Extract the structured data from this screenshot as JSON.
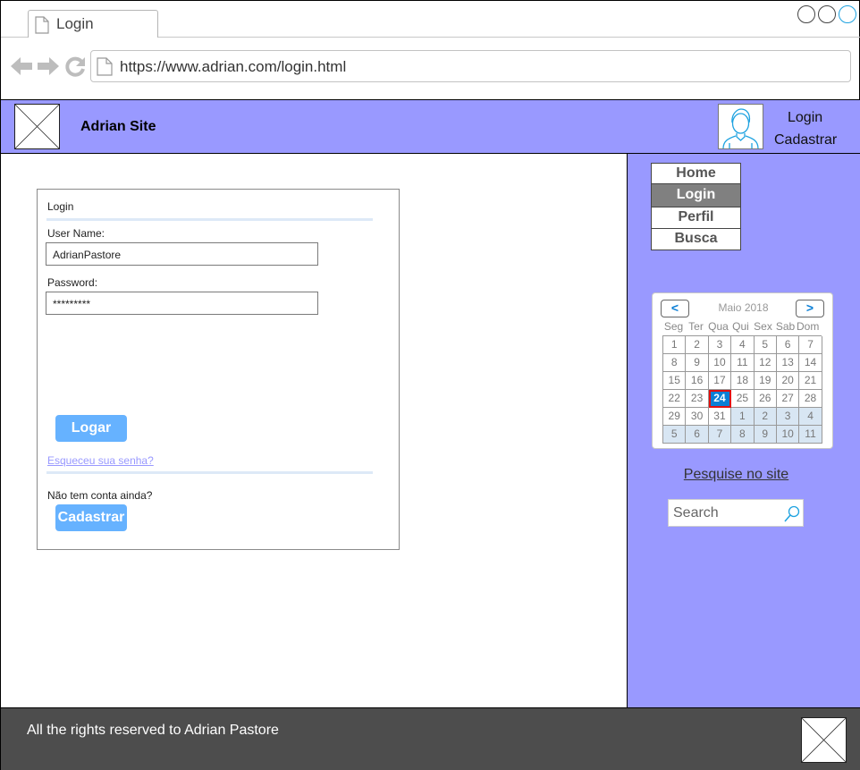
{
  "browser": {
    "tab_title": "Login",
    "url": "https://www.adrian.com/login.html",
    "colors": {
      "window_accent": "#1ea2e0"
    }
  },
  "header": {
    "site_title": "Adrian Site",
    "links": [
      "Login",
      "Cadastrar"
    ],
    "colors": {
      "background": "#9999ff"
    }
  },
  "login_form": {
    "title": "Login",
    "username_label": "User Name:",
    "username_value": "AdrianPastore",
    "password_label": "Password:",
    "password_value": "*********",
    "submit_label": "Logar",
    "forgot_link": "Esqueceu sua senha?",
    "no_account_text": "Não tem conta ainda?",
    "signup_label": "Cadastrar",
    "colors": {
      "button": "#66b2ff",
      "link": "#9999ff"
    }
  },
  "sidebar": {
    "menu": [
      {
        "label": "Home",
        "active": false
      },
      {
        "label": "Login",
        "active": true
      },
      {
        "label": "Perfil",
        "active": false
      },
      {
        "label": "Busca",
        "active": false
      }
    ],
    "calendar": {
      "prev_label": "<",
      "next_label": ">",
      "month_label": "Maio 2018",
      "weekdays": [
        "Seg",
        "Ter",
        "Qua",
        "Qui",
        "Sex",
        "Sab",
        "Dom"
      ],
      "weeks": [
        [
          [
            "1",
            false
          ],
          [
            "2",
            false
          ],
          [
            "3",
            false
          ],
          [
            "4",
            false
          ],
          [
            "5",
            false
          ],
          [
            "6",
            false
          ],
          [
            "7",
            false
          ]
        ],
        [
          [
            "8",
            false
          ],
          [
            "9",
            false
          ],
          [
            "10",
            false
          ],
          [
            "11",
            false
          ],
          [
            "12",
            false
          ],
          [
            "13",
            false
          ],
          [
            "14",
            false
          ]
        ],
        [
          [
            "15",
            false
          ],
          [
            "16",
            false
          ],
          [
            "17",
            false
          ],
          [
            "18",
            false
          ],
          [
            "19",
            false
          ],
          [
            "20",
            false
          ],
          [
            "21",
            false
          ]
        ],
        [
          [
            "22",
            false
          ],
          [
            "23",
            false
          ],
          [
            "24",
            false
          ],
          [
            "25",
            false
          ],
          [
            "26",
            false
          ],
          [
            "27",
            false
          ],
          [
            "28",
            false
          ]
        ],
        [
          [
            "29",
            false
          ],
          [
            "30",
            false
          ],
          [
            "31",
            false
          ],
          [
            "1",
            true
          ],
          [
            "2",
            true
          ],
          [
            "3",
            true
          ],
          [
            "4",
            true
          ]
        ],
        [
          [
            "5",
            true
          ],
          [
            "6",
            true
          ],
          [
            "7",
            true
          ],
          [
            "8",
            true
          ],
          [
            "9",
            true
          ],
          [
            "10",
            true
          ],
          [
            "11",
            true
          ]
        ]
      ],
      "selected_day": "24",
      "colors": {
        "selected": "#0a7fd6",
        "selected_border": "#e01010",
        "other_month": "#d8e6f3"
      }
    },
    "search_link": "Pesquise no site",
    "search_placeholder": "Search"
  },
  "footer": {
    "text": "All the rights reserved to Adrian Pastore",
    "colors": {
      "background": "#4d4d4d"
    }
  }
}
